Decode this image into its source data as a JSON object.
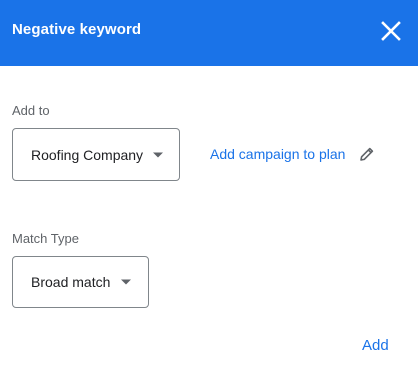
{
  "header": {
    "title": "Negative keyword",
    "close_icon": "close-icon",
    "background": "#1a73e8"
  },
  "add_to": {
    "label": "Add to",
    "selected": "Roofing Company",
    "link_text": "Add campaign to plan",
    "edit_icon": "pencil-icon"
  },
  "match_type": {
    "label": "Match Type",
    "selected": "Broad match"
  },
  "actions": {
    "add_label": "Add"
  },
  "colors": {
    "accent": "#1a73e8",
    "label_gray": "#5f6368",
    "text": "#202124"
  }
}
